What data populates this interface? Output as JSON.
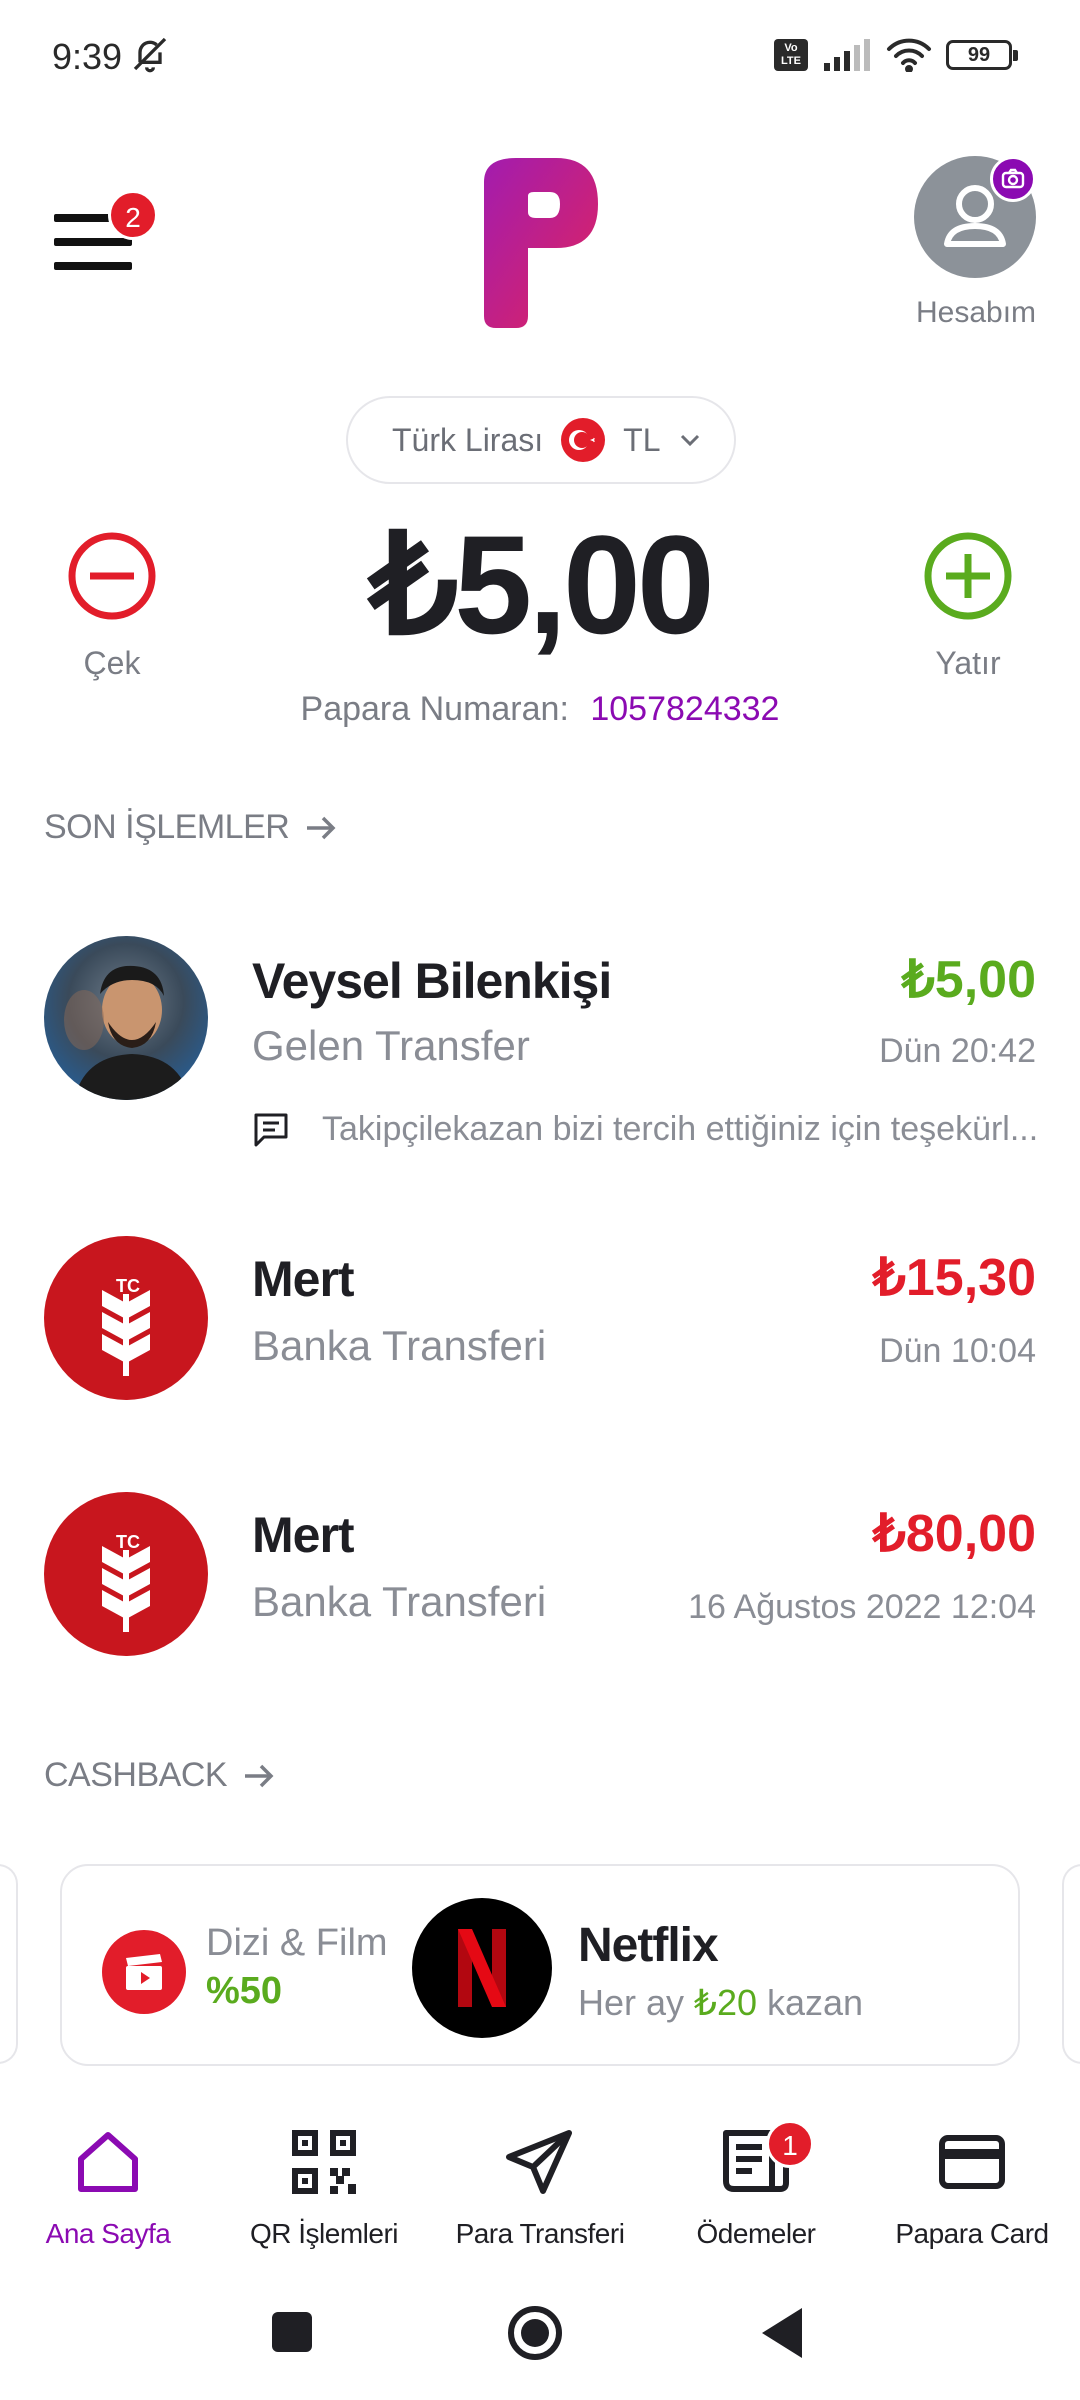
{
  "status_bar": {
    "time": "9:39",
    "volte": "Vo LTE",
    "battery": "99",
    "icons": [
      "bell-off-icon",
      "signal-icon",
      "wifi-icon",
      "battery-icon"
    ]
  },
  "header": {
    "menu_badge": "2",
    "account_label": "Hesabım",
    "icons": [
      "menu-icon",
      "papara-logo",
      "user-icon",
      "camera-icon"
    ]
  },
  "currency": {
    "label": "Türk Lirası",
    "code": "TL"
  },
  "balance": {
    "amount": "₺5,00",
    "withdraw_label": "Çek",
    "deposit_label": "Yatır",
    "papara_no_label": "Papara Numaran:",
    "papara_no": "1057824332"
  },
  "recent": {
    "title": "SON İŞLEMLER",
    "transactions": [
      {
        "name": "Veysel Bilenkişi",
        "type": "Gelen Transfer",
        "amount": "₺5,00",
        "date": "Dün 20:42",
        "note": "Takipçilekazan bizi tercih ettiğiniz için teşekürl...",
        "direction": "in"
      },
      {
        "name": "Mert",
        "type": "Banka Transferi",
        "amount": "₺15,30",
        "date": "Dün 10:04",
        "direction": "out"
      },
      {
        "name": "Mert",
        "type": "Banka Transferi",
        "amount": "₺80,00",
        "date": "16 Ağustos 2022 12:04",
        "direction": "out"
      }
    ]
  },
  "cashback": {
    "title": "CASHBACK",
    "card": {
      "category": "Dizi & Film",
      "percent": "%50",
      "brand": "Netflix",
      "offer_prefix": "Her ay",
      "offer_amount": "₺20",
      "offer_suffix": "kazan"
    }
  },
  "bottom_nav": {
    "items": [
      {
        "label": "Ana Sayfa",
        "icon": "home-icon",
        "active": true
      },
      {
        "label": "QR İşlemleri",
        "icon": "qr-icon"
      },
      {
        "label": "Para Transferi",
        "icon": "send-icon"
      },
      {
        "label": "Ödemeler",
        "icon": "bills-icon",
        "badge": "1"
      },
      {
        "label": "Papara Card",
        "icon": "card-icon"
      }
    ]
  },
  "colors": {
    "brand": "#8b0ab2",
    "positive": "#5aab1e",
    "negative": "#e21d2a"
  }
}
